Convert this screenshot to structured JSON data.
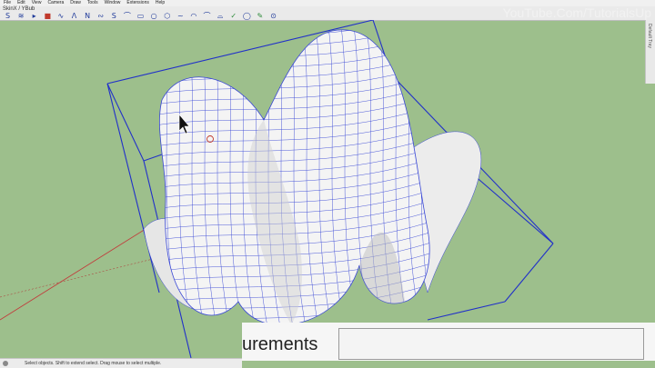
{
  "menubar": {
    "items": [
      "File",
      "Edit",
      "View",
      "Camera",
      "Draw",
      "Tools",
      "Window",
      "Extensions",
      "Help"
    ]
  },
  "toolbar": {
    "title": "SkinX / YBub",
    "tools": [
      {
        "icon": "skin-icon",
        "glyph": "S"
      },
      {
        "icon": "surface-icon",
        "glyph": "≋"
      },
      {
        "icon": "cursor-icon",
        "glyph": "▸"
      },
      {
        "icon": "stop-icon",
        "glyph": "■"
      },
      {
        "icon": "bezier-icon",
        "glyph": "∿"
      },
      {
        "icon": "polyline-icon",
        "glyph": "Λ"
      },
      {
        "icon": "wave-icon",
        "glyph": "N"
      },
      {
        "icon": "curve-icon",
        "glyph": "∾"
      },
      {
        "icon": "spline-icon",
        "glyph": "S"
      },
      {
        "icon": "arc-icon",
        "glyph": "⌒"
      },
      {
        "icon": "rect-icon",
        "glyph": "▭"
      },
      {
        "icon": "circle-icon",
        "glyph": "○"
      },
      {
        "icon": "polygon-icon",
        "glyph": "⬡"
      },
      {
        "icon": "freehand-icon",
        "glyph": "~"
      },
      {
        "icon": "arc2-icon",
        "glyph": "◠"
      },
      {
        "icon": "curve2-icon",
        "glyph": "⌒"
      },
      {
        "icon": "curve3-icon",
        "glyph": "⌓"
      },
      {
        "icon": "check-icon",
        "glyph": "✓"
      },
      {
        "icon": "circle2-icon",
        "glyph": "◯"
      },
      {
        "icon": "paint-icon",
        "glyph": "✎"
      },
      {
        "icon": "lasso-icon",
        "glyph": "⊙"
      }
    ]
  },
  "watermark": "YouTube.Com/TutorialsUp",
  "sidebar": {
    "label": "Default Tray"
  },
  "measurements": {
    "label": "urements",
    "value": ""
  },
  "status": {
    "text": "Select objects. Shift to extend select. Drag mouse to select multiple."
  },
  "colors": {
    "viewport_bg": "#9dbf8c",
    "bounding_box": "#2130c9",
    "mesh_line": "#3a48d6",
    "surface": "#f4f4f4"
  }
}
